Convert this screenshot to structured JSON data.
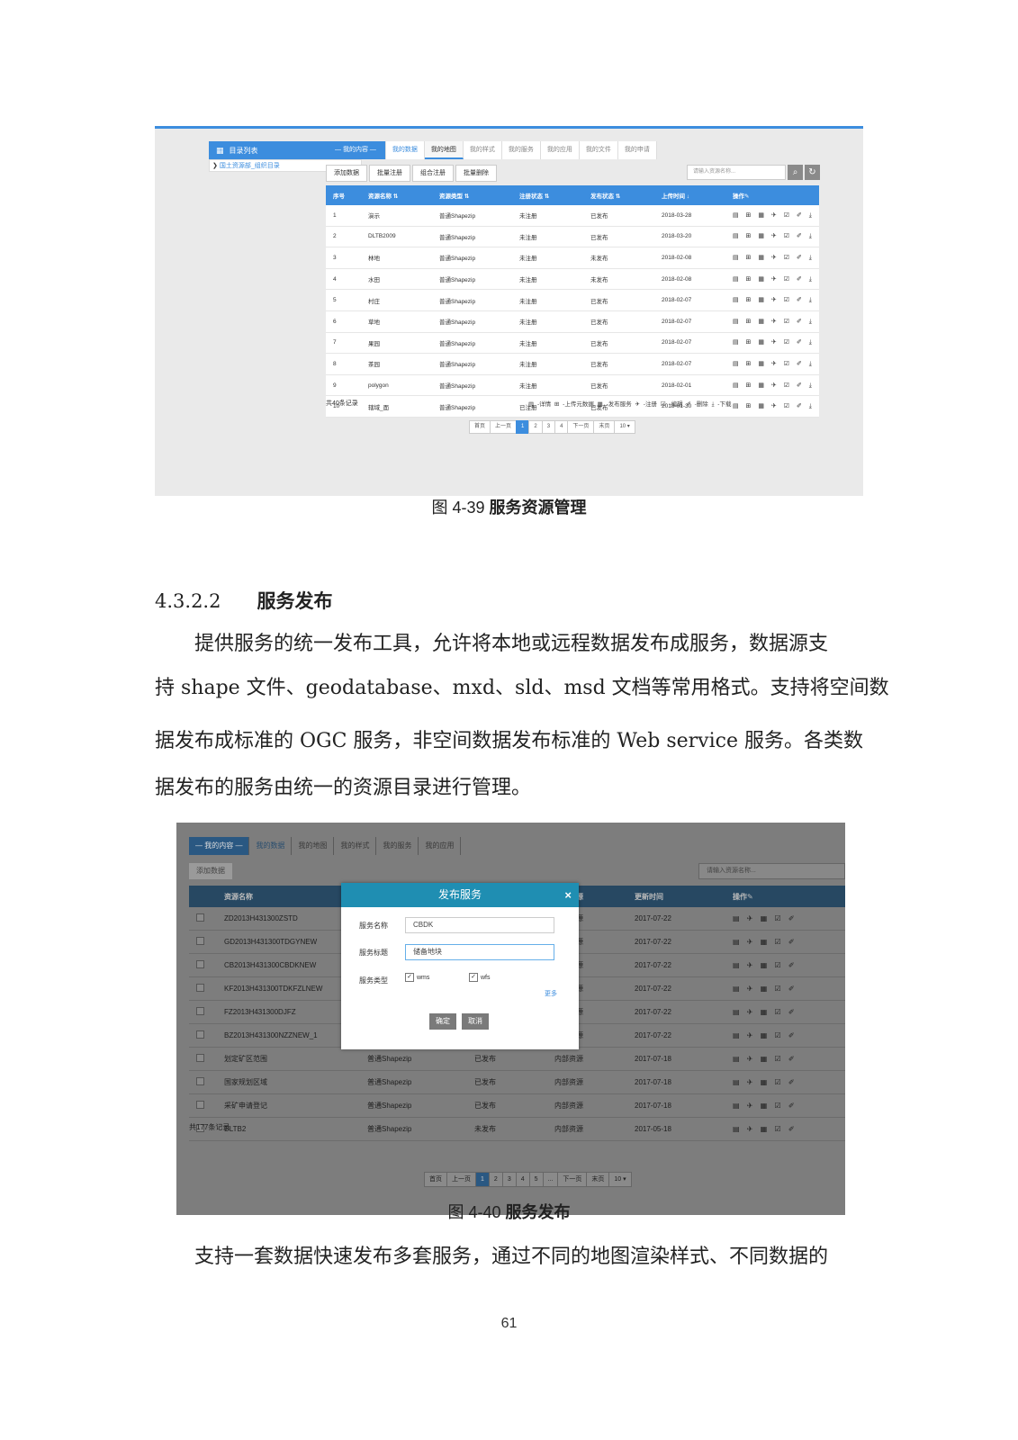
{
  "figure1": {
    "sidebar": {
      "header": "目录列表",
      "item": "国土资源部_组织目录"
    },
    "tabs": [
      "— 我的内容 —",
      "我的数据",
      "我的地图",
      "我的样式",
      "我的服务",
      "我的应用",
      "我的文件",
      "我的申请"
    ],
    "actions": [
      "添加数据",
      "批量注册",
      "组合注册",
      "批量删除"
    ],
    "search_placeholder": "请输入资源名称...",
    "columns": [
      "序号",
      "资源名称 ⇅",
      "资源类型 ⇅",
      "注册状态 ⇅",
      "发布状态 ⇅",
      "上传时间 ↓",
      "操作✎"
    ],
    "rows": [
      [
        "1",
        "演示",
        "普通Shapezip",
        "未注册",
        "已发布",
        "2018-03-28"
      ],
      [
        "2",
        "DLTB2009",
        "普通Shapezip",
        "未注册",
        "已发布",
        "2018-03-20"
      ],
      [
        "3",
        "林地",
        "普通Shapezip",
        "未注册",
        "未发布",
        "2018-02-08"
      ],
      [
        "4",
        "水田",
        "普通Shapezip",
        "未注册",
        "未发布",
        "2018-02-08"
      ],
      [
        "5",
        "村庄",
        "普通Shapezip",
        "未注册",
        "已发布",
        "2018-02-07"
      ],
      [
        "6",
        "草地",
        "普通Shapezip",
        "未注册",
        "已发布",
        "2018-02-07"
      ],
      [
        "7",
        "果园",
        "普通Shapezip",
        "未注册",
        "已发布",
        "2018-02-07"
      ],
      [
        "8",
        "茶园",
        "普通Shapezip",
        "未注册",
        "已发布",
        "2018-02-07"
      ],
      [
        "9",
        "polygon",
        "普通Shapezip",
        "未注册",
        "已发布",
        "2018-02-01"
      ],
      [
        "10",
        "辖域_面",
        "普通Shapezip",
        "已注册",
        "已发布",
        "2018-01-30"
      ]
    ],
    "ops_icons": "▤ ⊞ ▦ ✈ ☑ ✐ ⤓",
    "total": "共40条记录",
    "legend": "▤ -详情  ⊞ -上传元数据  ▦ -发布服务  ✈ -注册  ☑ -编辑  ✐ -删除  ⤓ -下载",
    "pager": [
      "首页",
      "上一页",
      "1",
      "2",
      "3",
      "4",
      "下一页",
      "末页",
      "10 ▾"
    ]
  },
  "caption1": {
    "prefix": "图 4-39 ",
    "title": "服务资源管理"
  },
  "section": {
    "number": "4.3.2.2",
    "title": "服务发布"
  },
  "paragraphs": [
    "　　提供服务的统一发布工具，允许将本地或远程数据发布成服务，数据源支",
    "持 shape 文件、geodatabase、mxd、sld、msd 文档等常用格式。支持将空间数",
    "据发布成标准的 OGC 服务，非空间数据发布标准的 Web service 服务。各类数",
    "据发布的服务由统一的资源目录进行管理。"
  ],
  "figure2": {
    "tabs": [
      "— 我的内容 —",
      "我的数据",
      "我的地图",
      "我的样式",
      "我的服务",
      "我的应用"
    ],
    "add_button": "添加数据",
    "search_placeholder": "请输入资源名称...",
    "columns": [
      "",
      "资源名称",
      "",
      "",
      "数据来源",
      "更新时间",
      "操作✎"
    ],
    "rows": [
      [
        "ZD2013H431300ZSTD",
        "",
        "",
        "内部资源",
        "2017-07-22"
      ],
      [
        "GD2013H431300TDGYNEW",
        "",
        "",
        "内部资源",
        "2017-07-22"
      ],
      [
        "CB2013H431300CBDKNEW",
        "",
        "",
        "内部资源",
        "2017-07-22"
      ],
      [
        "KF2013H431300TDKFZLNEW",
        "",
        "",
        "内部资源",
        "2017-07-22"
      ],
      [
        "FZ2013H431300DJFZ",
        "",
        "",
        "内部资源",
        "2017-07-22"
      ],
      [
        "BZ2013H431300NZZNEW_1",
        "",
        "",
        "内部资源",
        "2017-07-22"
      ],
      [
        "划定矿区范围",
        "普通Shapezip",
        "已发布",
        "内部资源",
        "2017-07-18"
      ],
      [
        "国家规划区域",
        "普通Shapezip",
        "已发布",
        "内部资源",
        "2017-07-18"
      ],
      [
        "采矿申请登记",
        "普通Shapezip",
        "已发布",
        "内部资源",
        "2017-07-18"
      ],
      [
        "DLTB2",
        "普通Shapezip",
        "未发布",
        "内部资源",
        "2017-05-18"
      ]
    ],
    "ops_icons": "▤ ✈ ▦ ☑ ✐",
    "total": "共177条记录",
    "pager": [
      "首页",
      "上一页",
      "1",
      "2",
      "3",
      "4",
      "5",
      "...",
      "下一页",
      "末页",
      "10 ▾"
    ],
    "dialog": {
      "title": "发布服务",
      "close": "×",
      "name_label": "服务名称",
      "name_value": "CBDK",
      "title_label": "服务标题",
      "title_value": "储备地块",
      "type_label": "服务类型",
      "type_wms": "wms",
      "type_wfs": "wfs",
      "more": "更多",
      "ok": "确定",
      "cancel": "取消"
    }
  },
  "caption2": {
    "prefix": "图 4-40 ",
    "title": "服务发布"
  },
  "paragraph_last": "　　支持一套数据快速发布多套服务，通过不同的地图渲染样式、不同数据的",
  "page_number": "61"
}
